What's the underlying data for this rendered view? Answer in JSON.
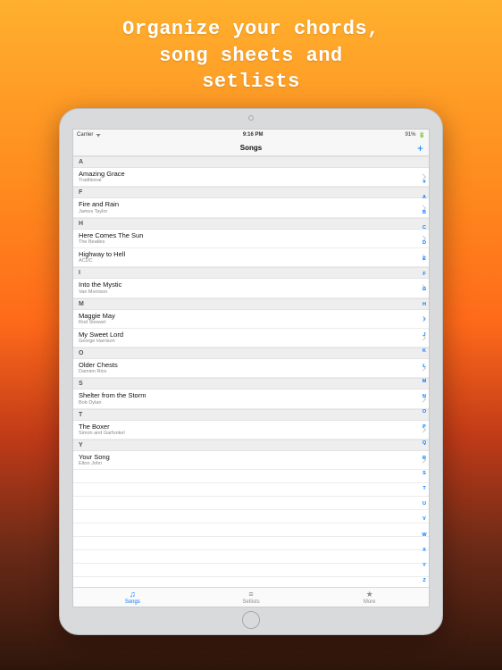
{
  "hero_lines": [
    "Organize your chords,",
    "song sheets and",
    "setlists"
  ],
  "status": {
    "carrier": "Carrier",
    "wifi": "ᯤ",
    "time": "9:16 PM",
    "battery": "91%",
    "battery_glyph": "🔋"
  },
  "nav": {
    "title": "Songs",
    "add_glyph": "+"
  },
  "index_letters": [
    "#",
    "A",
    "B",
    "C",
    "D",
    "E",
    "F",
    "G",
    "H",
    "I",
    "J",
    "K",
    "L",
    "M",
    "N",
    "O",
    "P",
    "Q",
    "R",
    "S",
    "T",
    "U",
    "V",
    "W",
    "X",
    "Y",
    "Z"
  ],
  "sections": [
    {
      "letter": "A",
      "rows": [
        {
          "title": "Amazing Grace",
          "subtitle": "Traditional"
        }
      ]
    },
    {
      "letter": "F",
      "rows": [
        {
          "title": "Fire and Rain",
          "subtitle": "James Taylor"
        }
      ]
    },
    {
      "letter": "H",
      "rows": [
        {
          "title": "Here Comes The Sun",
          "subtitle": "The Beatles"
        },
        {
          "title": "Highway to Hell",
          "subtitle": "ACDC"
        }
      ]
    },
    {
      "letter": "I",
      "rows": [
        {
          "title": "Into the Mystic",
          "subtitle": "Van Morrison"
        }
      ]
    },
    {
      "letter": "M",
      "rows": [
        {
          "title": "Maggie May",
          "subtitle": "Rod Stewart"
        },
        {
          "title": "My Sweet Lord",
          "subtitle": "George Harrison"
        }
      ]
    },
    {
      "letter": "O",
      "rows": [
        {
          "title": "Older Chests",
          "subtitle": "Damien Rice"
        }
      ]
    },
    {
      "letter": "S",
      "rows": [
        {
          "title": "Shelter from the Storm",
          "subtitle": "Bob Dylan"
        }
      ]
    },
    {
      "letter": "T",
      "rows": [
        {
          "title": "The Boxer",
          "subtitle": "Simon and Garfunkel"
        }
      ]
    },
    {
      "letter": "Y",
      "rows": [
        {
          "title": "Your Song",
          "subtitle": "Elton John"
        }
      ]
    }
  ],
  "tabs": [
    {
      "name": "songs",
      "label": "Songs",
      "icon": "♫",
      "active": true
    },
    {
      "name": "setlists",
      "label": "Setlists",
      "icon": "≡",
      "active": false
    },
    {
      "name": "more",
      "label": "More",
      "icon": "★",
      "active": false
    }
  ]
}
